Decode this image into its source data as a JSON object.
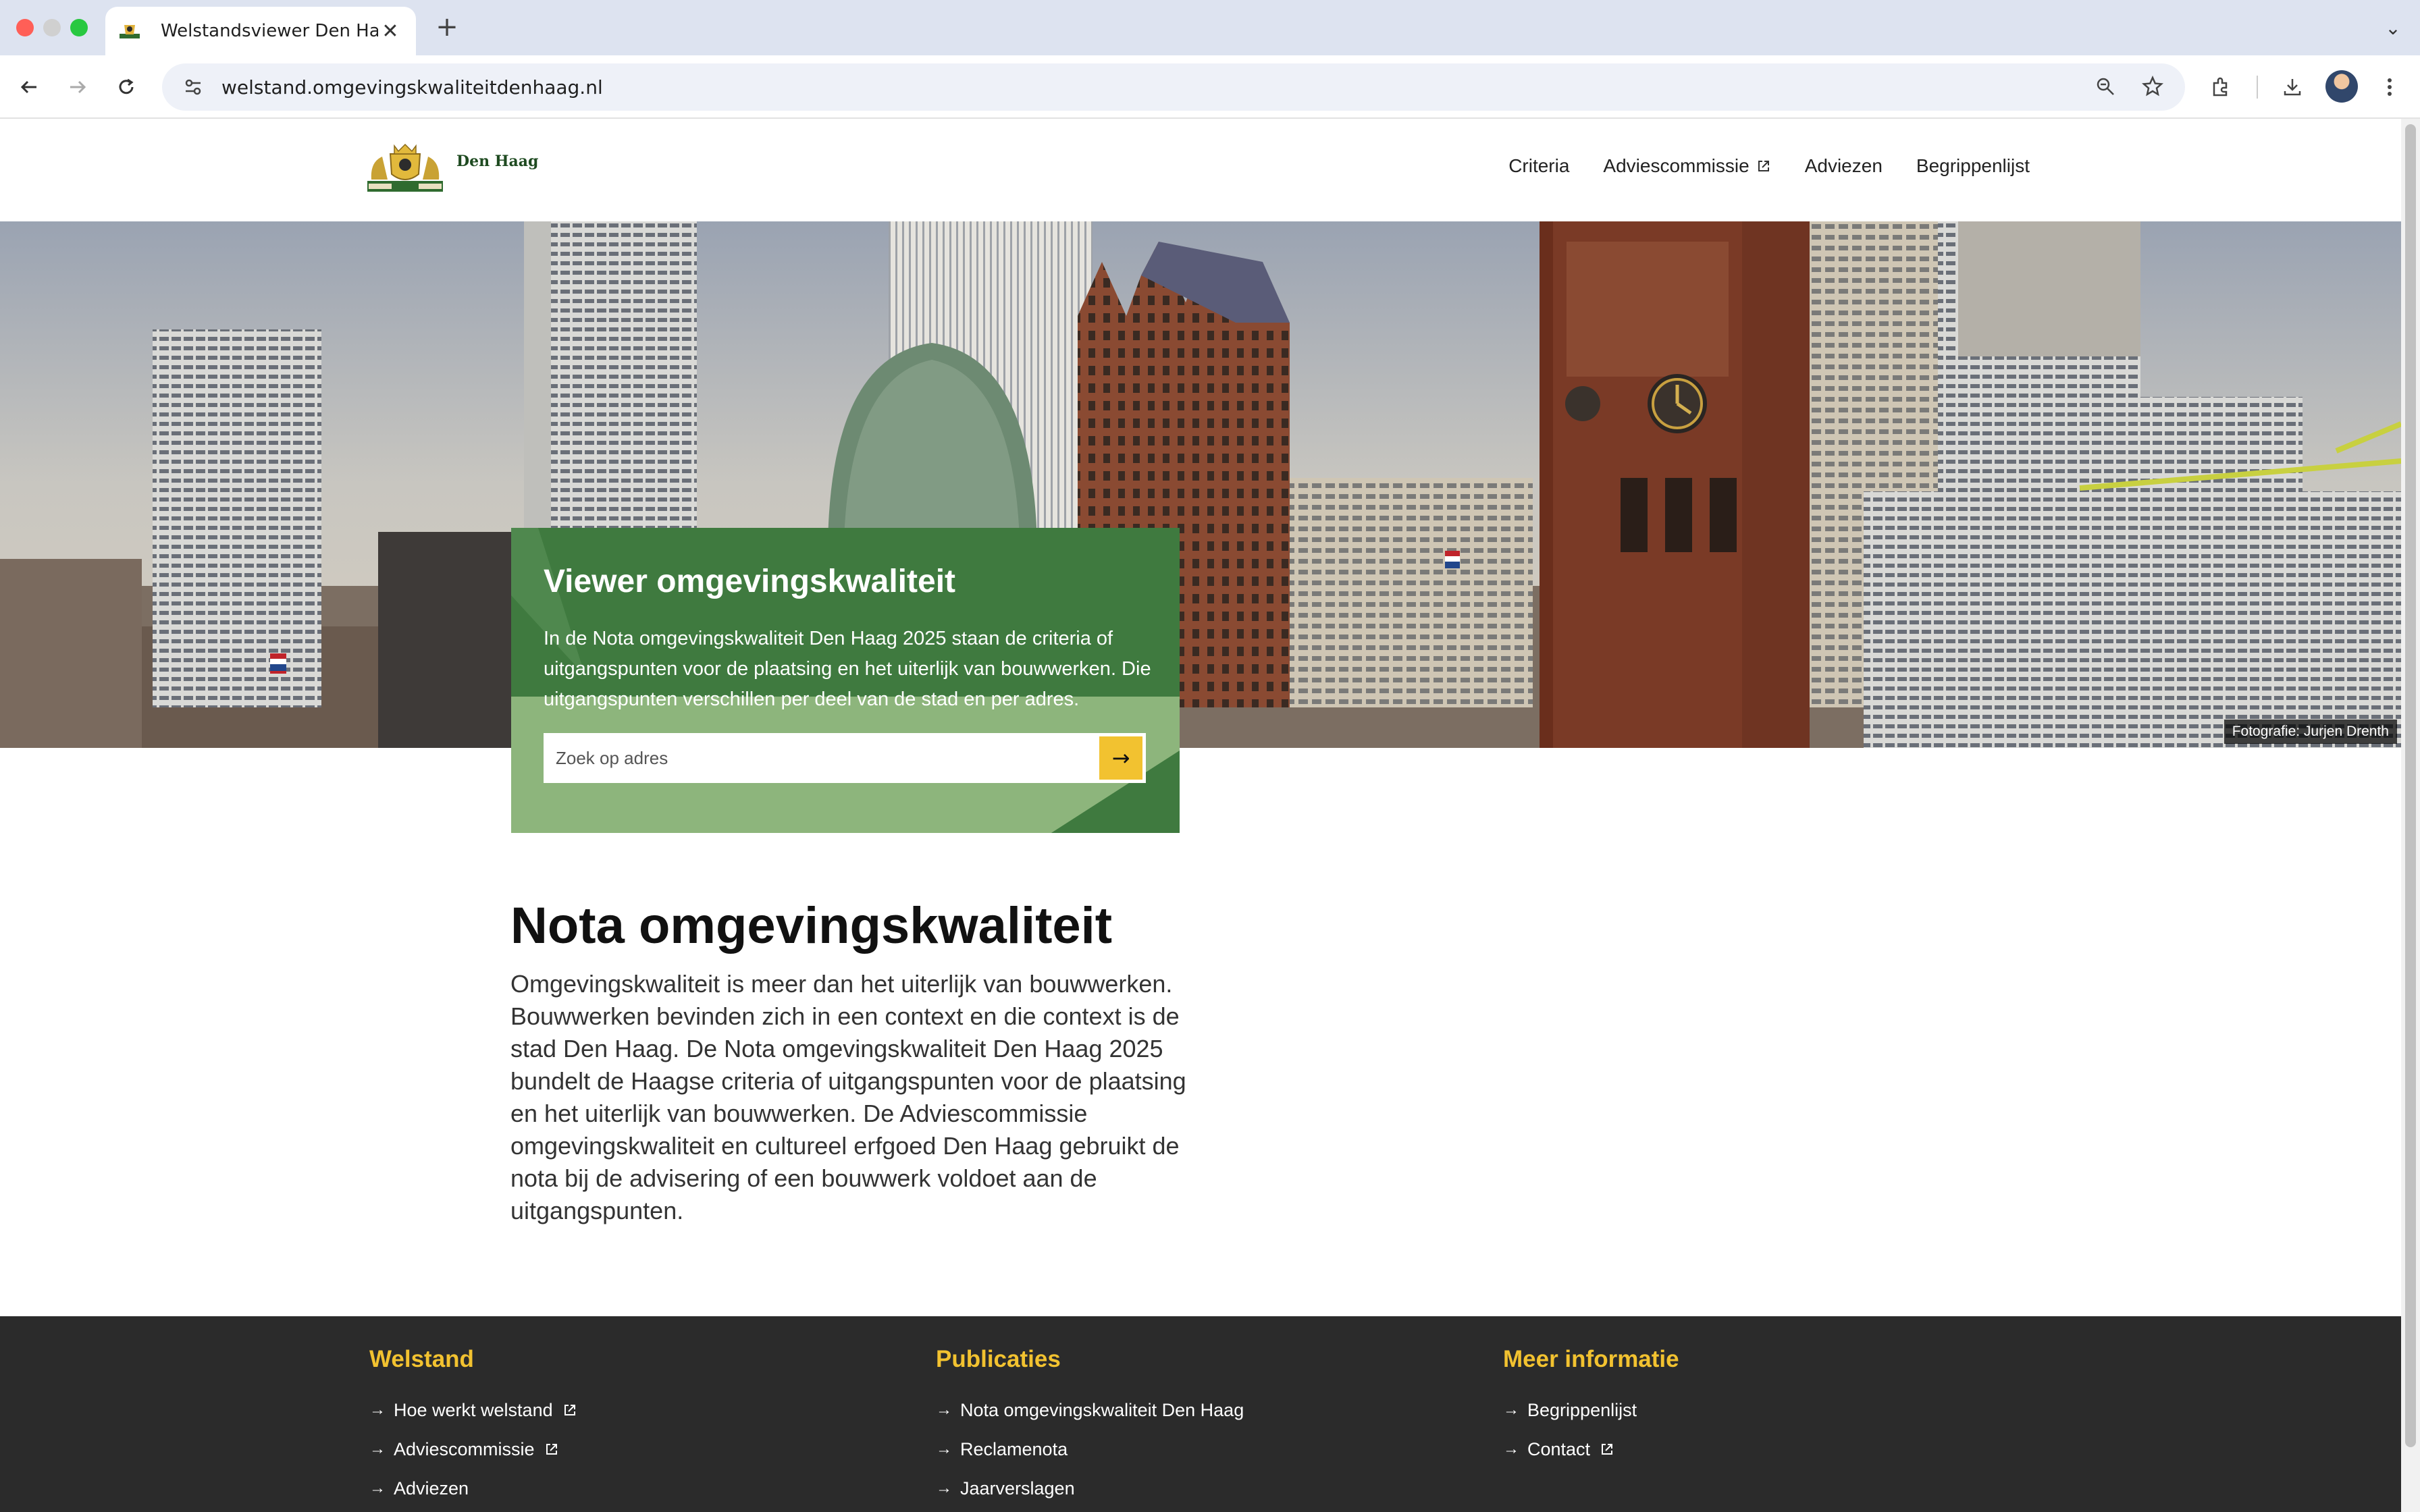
{
  "browser": {
    "tab_title": "Welstandsviewer Den Haag",
    "tab_close": "✕",
    "new_tab": "+",
    "tab_menu": "⌄",
    "url": "welstand.omgevingskwaliteitdenhaag.nl",
    "icons": [
      "back-icon",
      "forward-icon",
      "reload-icon",
      "site-info-icon",
      "zoom-icon",
      "bookmark-star-icon",
      "extensions-icon",
      "download-icon",
      "profile-avatar",
      "kebab-menu-icon"
    ]
  },
  "site": {
    "logo_text": "Den Haag",
    "nav": [
      {
        "label": "Criteria",
        "external": false
      },
      {
        "label": "Adviescommissie",
        "external": true
      },
      {
        "label": "Adviezen",
        "external": false
      },
      {
        "label": "Begrippenlijst",
        "external": false
      }
    ]
  },
  "hero": {
    "photo_credit": "Fotografie: Jurjen Drenth"
  },
  "viewer": {
    "title": "Viewer omgevingskwaliteit",
    "description": "In de Nota omgevingskwaliteit Den Haag 2025 staan de criteria of uitgangspunten voor de plaatsing en het uiterlijk van bouwwerken. Die uitgangspunten verschillen per deel van de stad en per adres.",
    "search_placeholder": "Zoek op adres",
    "search_button": "→"
  },
  "content": {
    "title": "Nota omgevingskwaliteit",
    "text": "Omgevingskwaliteit is meer dan het uiterlijk van bouwwerken. Bouwwerken bevinden zich in een context en die context is de stad Den Haag. De Nota omgevingskwaliteit Den Haag 2025 bundelt de Haagse criteria of uitgangspunten voor de plaatsing en het uiterlijk van bouwwerken. De Adviescommissie omgevingskwaliteit en cultureel erfgoed Den Haag gebruikt de nota bij de advisering of een bouwwerk voldoet aan de uitgangspunten."
  },
  "footer": {
    "columns": [
      {
        "heading": "Welstand",
        "links": [
          {
            "label": "Hoe werkt welstand",
            "external": true
          },
          {
            "label": "Adviescommissie",
            "external": true
          },
          {
            "label": "Adviezen",
            "external": false
          }
        ]
      },
      {
        "heading": "Publicaties",
        "links": [
          {
            "label": "Nota omgevingskwaliteit Den Haag",
            "external": false
          },
          {
            "label": "Reclamenota",
            "external": false
          },
          {
            "label": "Jaarverslagen",
            "external": false
          }
        ]
      },
      {
        "heading": "Meer informatie",
        "links": [
          {
            "label": "Begrippenlijst",
            "external": false
          },
          {
            "label": "Contact",
            "external": true
          }
        ]
      }
    ]
  },
  "colors": {
    "brand_green": "#3f7a3f",
    "accent_yellow": "#f2c230",
    "footer_bg": "#2b2b2b"
  }
}
